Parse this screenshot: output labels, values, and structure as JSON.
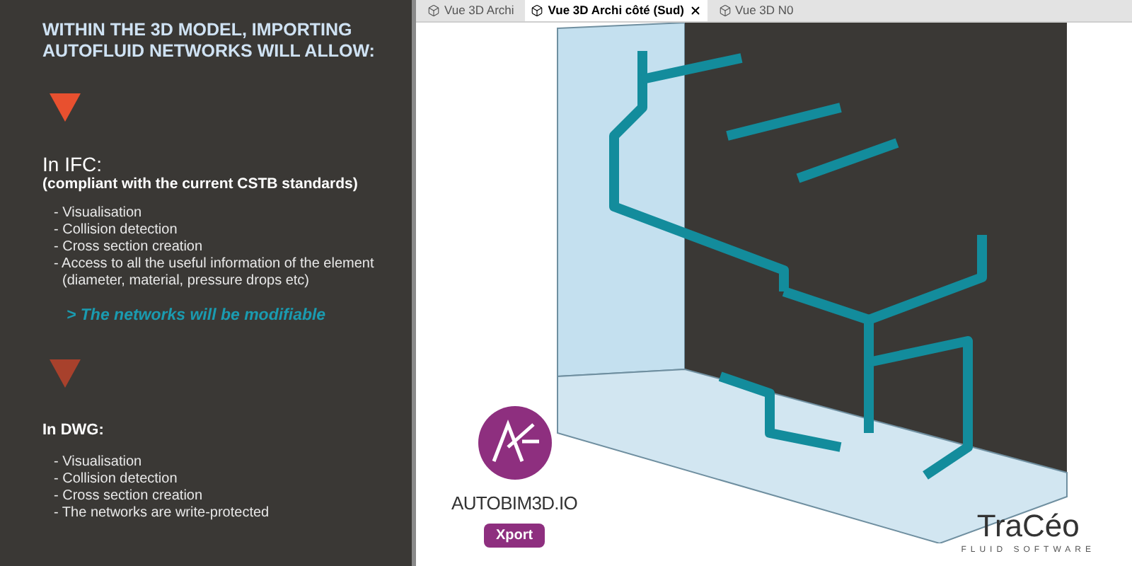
{
  "headline": "WITHIN THE 3D MODEL, IMPORTING AUTOFLUID NETWORKS WILL ALLOW:",
  "sections": [
    {
      "title": "In IFC:",
      "subtitle": "(compliant with the current CSTB standards)",
      "items": [
        "- Visualisation",
        "- Collision detection",
        "- Cross section creation",
        "- Access to all the useful information of the element (diameter, material, pressure drops etc)"
      ],
      "note": "> The networks will be modifiable",
      "color": "#e8502f"
    },
    {
      "title": "In DWG:",
      "items": [
        "- Visualisation",
        "- Collision detection",
        "- Cross section creation",
        "- The networks are write-protected"
      ],
      "color": "#a8412c"
    }
  ],
  "tabs": [
    {
      "label": "Vue 3D Archi",
      "selected": false
    },
    {
      "label": "Vue 3D Archi côté (Sud)",
      "selected": true
    },
    {
      "label": "Vue 3D N0",
      "selected": false
    }
  ],
  "product": {
    "name": "AUTOBIM3D.IO",
    "badge": "Xport"
  },
  "brand": {
    "name": "TraCéo",
    "tagline": "FLUID SOFTWARE"
  }
}
